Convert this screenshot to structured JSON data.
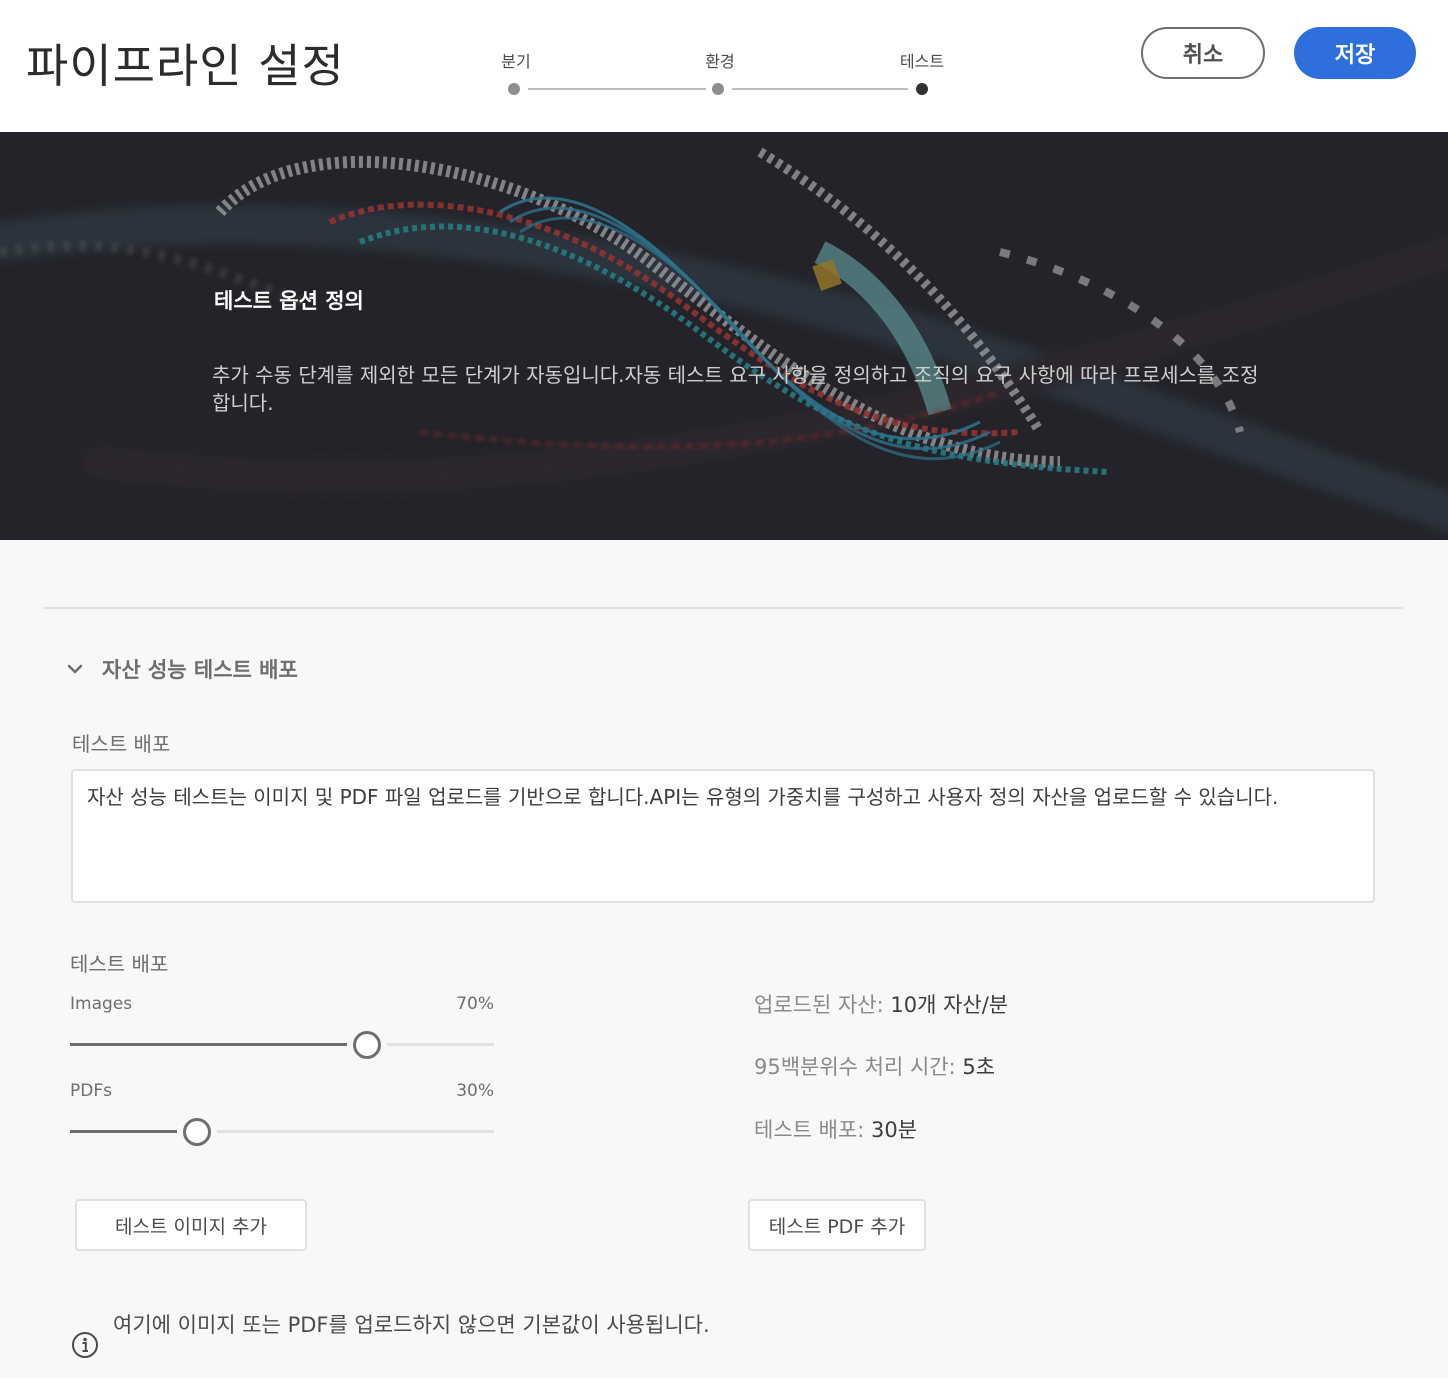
{
  "header": {
    "title": "파이프라인 설정",
    "steps": [
      {
        "label": "분기",
        "state": "complete"
      },
      {
        "label": "환경",
        "state": "complete"
      },
      {
        "label": "테스트",
        "state": "current"
      }
    ],
    "cancel_label": "취소",
    "save_label": "저장"
  },
  "hero": {
    "title": "테스트 옵션 정의",
    "description": "추가 수동 단계를 제외한 모든 단계가 자동입니다.자동 테스트 요구 사항을 정의하고 조직의 요구 사항에 따라 프로세스를 조정합니다."
  },
  "section": {
    "title": "자산 성능 테스트 배포",
    "expanded": true,
    "description_label": "테스트 배포",
    "description_value": "자산 성능 테스트는 이미지 및 PDF 파일 업로드를 기반으로 합니다.API는 유형의 가중치를 구성하고 사용자 정의 자산을 업로드할 수 있습니다.",
    "distribution_label": "테스트 배포",
    "sliders": [
      {
        "label": "Images",
        "value_text": "70%",
        "value": 0.7
      },
      {
        "label": "PDFs",
        "value_text": "30%",
        "value": 0.3
      }
    ],
    "stats": [
      {
        "key": "업로드된 자산:",
        "value": "10개 자산/분"
      },
      {
        "key": "95백분위수 처리 시간:",
        "value": "5초"
      },
      {
        "key": "테스트 배포:",
        "value": "30분"
      }
    ],
    "add_images_label": "테스트 이미지 추가",
    "add_pdf_label": "테스트 PDF 추가",
    "info_text": "여기에 이미지 또는 PDF를 업로드하지 않으면 기본값이 사용됩니다."
  },
  "colors": {
    "accent": "#2f6fdc",
    "hero_bg": "#26262c",
    "page_bg": "#f8f8f8"
  },
  "icons": {
    "section_toggle": "chevron-down-icon",
    "info": "info-icon"
  }
}
